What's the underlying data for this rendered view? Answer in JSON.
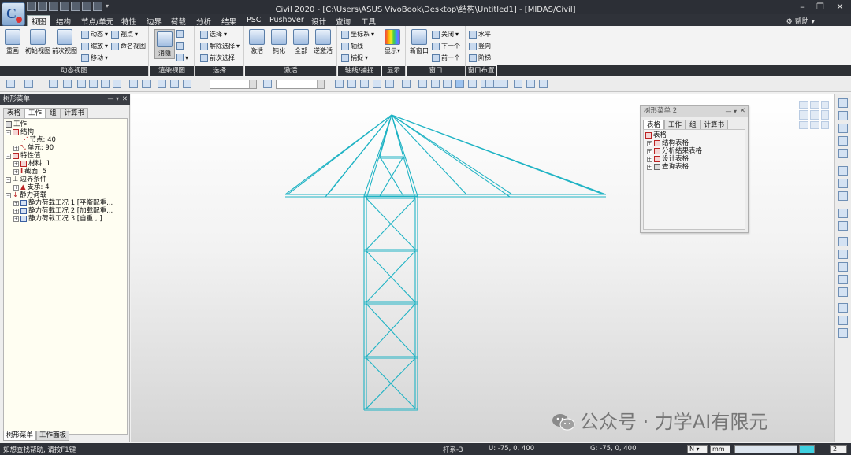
{
  "window": {
    "title": "Civil 2020 - [C:\\Users\\ASUS VivoBook\\Desktop\\结构\\Untitled1] - [MIDAS/Civil]",
    "help": "帮助"
  },
  "menu": {
    "items": [
      "视图",
      "结构",
      "节点/单元",
      "特性",
      "边界",
      "荷载",
      "分析",
      "结果",
      "PSC",
      "Pushover",
      "设计",
      "查询",
      "工具"
    ],
    "active": "视图"
  },
  "ribbon": {
    "dyn": {
      "label": "动态视图",
      "regen": "重画",
      "init": "初始视图",
      "prev": "前次视图",
      "move": "动态",
      "zoom": "缩放",
      "pan": "移动",
      "view": "视点",
      "named": "命名视图"
    },
    "render": {
      "label": "渲染视图",
      "hide": "消隐"
    },
    "select": {
      "label": "选择",
      "sel": "选择",
      "unsel": "解除选择",
      "prevsel": "前次选择"
    },
    "activate": {
      "label": "激活",
      "act": "激活",
      "pass": "钝化",
      "all": "全部",
      "inv": "逆激活"
    },
    "axis": {
      "label": "轴线/捕捉",
      "coord": "坐标系",
      "axis": "轴线",
      "snap": "捕捉"
    },
    "display": {
      "label": "显示",
      "disp": "显示"
    },
    "window": {
      "label": "窗口",
      "new": "新窗口",
      "close": "关闭",
      "next": "下一个",
      "prev": "前一个"
    },
    "layout": {
      "label": "窗口布置",
      "h": "水平",
      "v": "竖向",
      "cascade": "阶梯"
    }
  },
  "left_panel": {
    "title": "树形菜单",
    "tabs": [
      "表格",
      "工作",
      "组",
      "计算书"
    ],
    "active_tab": "工作",
    "tree": [
      {
        "text": "工作"
      },
      {
        "text": "结构"
      },
      {
        "text": "节点: 40"
      },
      {
        "text": "单元: 90"
      },
      {
        "text": "特性值"
      },
      {
        "text": "材料: 1"
      },
      {
        "text": "截面: 5"
      },
      {
        "text": "边界条件"
      },
      {
        "text": "支承: 4"
      },
      {
        "text": "静力荷载"
      },
      {
        "text": "静力荷载工况 1 [平衡配重..."
      },
      {
        "text": "静力荷载工况 2 [加载配重..."
      },
      {
        "text": "静力荷载工况 3 [自重 , ]"
      }
    ],
    "bottom_tabs": [
      "树形菜单",
      "工作面板"
    ]
  },
  "tree2": {
    "title": "树形菜单 2",
    "tabs": [
      "表格",
      "工作",
      "组",
      "计算书"
    ],
    "active_tab": "表格",
    "items": [
      "表格",
      "结构表格",
      "分析结果表格",
      "设计表格",
      "查询表格"
    ]
  },
  "status": {
    "hint": "如想查找帮助, 请按F1键",
    "member": "杆系-3",
    "u": "U: -75, 0, 400",
    "g": "G: -75, 0, 400",
    "unit_force": "N",
    "unit_len": "mm",
    "num": "2"
  },
  "watermark": "公众号 · 力学AI有限元",
  "colors": {
    "model": "#1fb3c4",
    "panel": "#2f3239",
    "tree_bg": "#fffef2"
  }
}
